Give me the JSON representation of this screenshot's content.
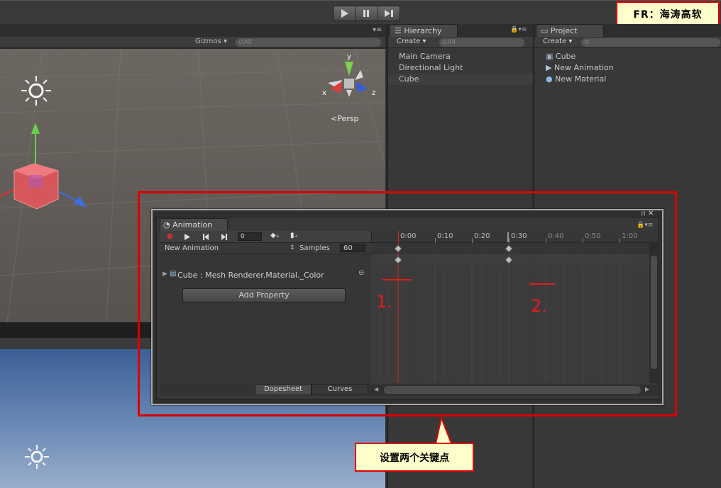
{
  "overlay": {
    "title": "FR：海涛高软",
    "callout": "设置两个关键点",
    "mark1": "1.",
    "mark2": "2."
  },
  "toolbar": {
    "play": "play-icon",
    "pause": "pause-icon",
    "step": "step-icon"
  },
  "scene": {
    "gizmos": "Gizmos",
    "search": "⊙All",
    "persp": "Persp",
    "axis_x": "x",
    "axis_y": "y",
    "axis_z": "z"
  },
  "hierarchy": {
    "tab": "Hierarchy",
    "create": "Create",
    "search": "⊙All",
    "items": [
      "Main Camera",
      "Directional Light",
      "Cube"
    ]
  },
  "project": {
    "tab": "Project",
    "create": "Create",
    "items": [
      "Cube",
      "New Animation",
      "New Material"
    ]
  },
  "animation": {
    "tab": "Animation",
    "frame": "0",
    "clip": "New Animation",
    "samples_label": "Samples",
    "samples": "60",
    "property": "Cube : Mesh Renderer.Material._Color",
    "add_property": "Add Property",
    "dopesheet": "Dopesheet",
    "curves": "Curves",
    "ticks": [
      "0:00",
      "0:10",
      "0:20",
      "0:30",
      "0:40",
      "0:50",
      "1:00"
    ],
    "keyframes": [
      "0:00",
      "0:30"
    ]
  },
  "colors": {
    "highlight": "#dc0000",
    "callout_bg": "#ffffcc"
  }
}
